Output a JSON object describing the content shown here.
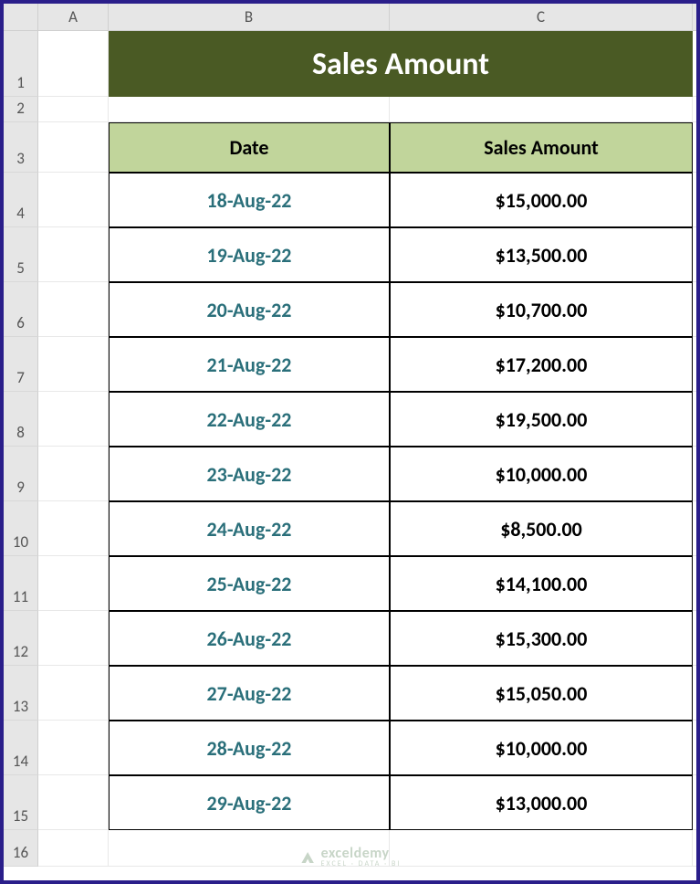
{
  "columns": [
    "A",
    "B",
    "C"
  ],
  "rows": [
    "1",
    "2",
    "3",
    "4",
    "5",
    "6",
    "7",
    "8",
    "9",
    "10",
    "11",
    "12",
    "13",
    "14",
    "15",
    "16"
  ],
  "title": "Sales Amount",
  "headers": {
    "date": "Date",
    "amount": "Sales Amount"
  },
  "data": [
    {
      "date": "18-Aug-22",
      "amount": "$15,000.00"
    },
    {
      "date": "19-Aug-22",
      "amount": "$13,500.00"
    },
    {
      "date": "20-Aug-22",
      "amount": "$10,700.00"
    },
    {
      "date": "21-Aug-22",
      "amount": "$17,200.00"
    },
    {
      "date": "22-Aug-22",
      "amount": "$19,500.00"
    },
    {
      "date": "23-Aug-22",
      "amount": "$10,000.00"
    },
    {
      "date": "24-Aug-22",
      "amount": "$8,500.00"
    },
    {
      "date": "25-Aug-22",
      "amount": "$14,100.00"
    },
    {
      "date": "26-Aug-22",
      "amount": "$15,300.00"
    },
    {
      "date": "27-Aug-22",
      "amount": "$15,050.00"
    },
    {
      "date": "28-Aug-22",
      "amount": "$10,000.00"
    },
    {
      "date": "29-Aug-22",
      "amount": "$13,000.00"
    }
  ],
  "watermark": {
    "name": "exceldemy",
    "tagline": "EXCEL · DATA · BI"
  }
}
